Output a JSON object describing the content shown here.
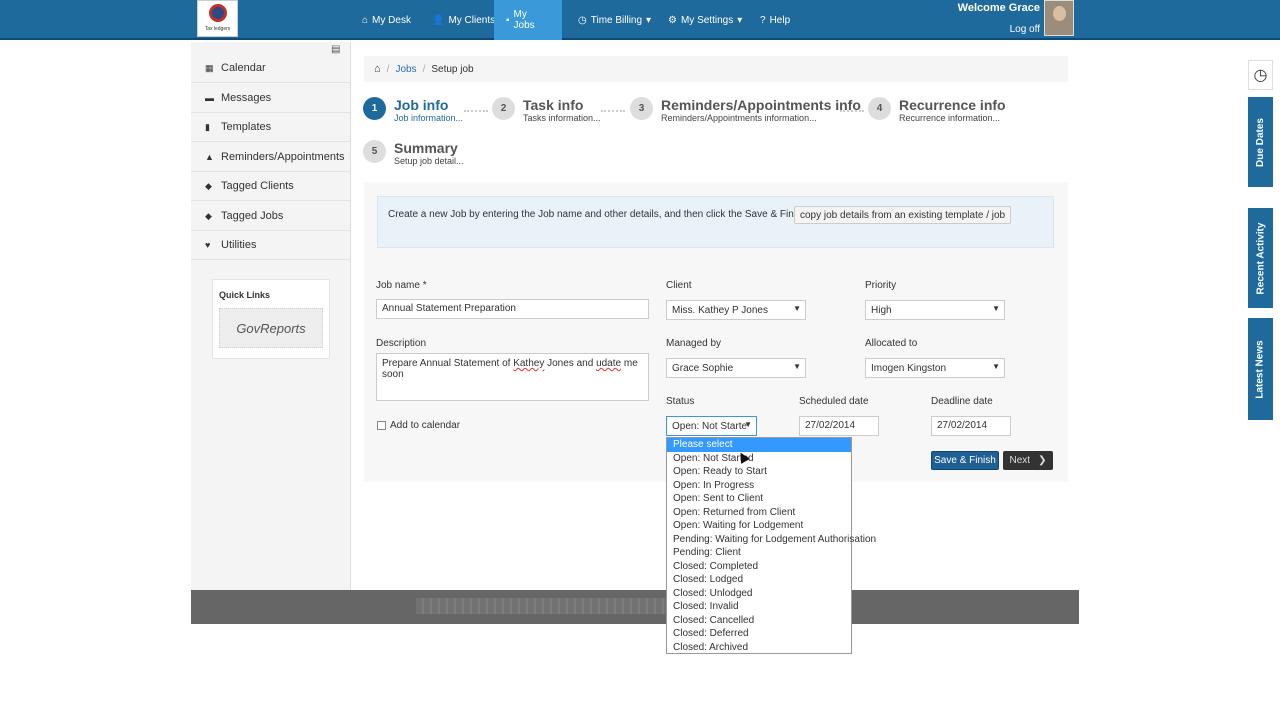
{
  "topbar": {
    "logo_caption": "Tax ledgers",
    "nav": [
      {
        "label": "My Desk",
        "icon": "home-icon",
        "glyph": "⌂"
      },
      {
        "label": "My Clients",
        "icon": "users-icon",
        "glyph": "👤"
      },
      {
        "label": "My Jobs",
        "icon": "briefcase-icon",
        "glyph": "▪"
      },
      {
        "label": "Time Billing",
        "icon": "clock-icon",
        "glyph": "◷"
      },
      {
        "label": "My Settings",
        "icon": "gear-icon",
        "glyph": "⚙"
      },
      {
        "label": "Help",
        "icon": "help-icon",
        "glyph": "?"
      }
    ],
    "welcome": "Welcome Grace",
    "logoff": "Log off"
  },
  "sidebar": {
    "items": [
      {
        "label": "Calendar",
        "icon": "calendar-icon",
        "glyph": "▦"
      },
      {
        "label": "Messages",
        "icon": "messages-icon",
        "glyph": "▬"
      },
      {
        "label": "Templates",
        "icon": "document-icon",
        "glyph": "▮"
      },
      {
        "label": "Reminders/Appointments",
        "icon": "bell-icon",
        "glyph": "▲"
      },
      {
        "label": "Tagged Clients",
        "icon": "tag-icon",
        "glyph": "◆"
      },
      {
        "label": "Tagged Jobs",
        "icon": "tag-icon",
        "glyph": "◆"
      },
      {
        "label": "Utilities",
        "icon": "heart-icon",
        "glyph": "♥"
      }
    ],
    "quick_links_title": "Quick Links",
    "govreports_label": "GovReports"
  },
  "breadcrumb": {
    "jobs": "Jobs",
    "current": "Setup job"
  },
  "steps": [
    {
      "num": "1",
      "title": "Job info",
      "sub": "Job information..."
    },
    {
      "num": "2",
      "title": "Task info",
      "sub": "Tasks information..."
    },
    {
      "num": "3",
      "title": "Reminders/Appointments info",
      "sub": "Reminders/Appointments information..."
    },
    {
      "num": "4",
      "title": "Recurrence info",
      "sub": "Recurrence information..."
    },
    {
      "num": "5",
      "title": "Summary",
      "sub": "Setup job detail..."
    }
  ],
  "info": {
    "text": "Create a new Job by entering the Job name and other details, and then click the Save & Finish button.  or",
    "copy_button": "copy job details from an existing template / job"
  },
  "form": {
    "job_name_label": "Job name *",
    "job_name_value": "Annual Statement Preparation",
    "client_label": "Client",
    "client_value": "Miss. Kathey P Jones",
    "priority_label": "Priority",
    "priority_value": "High",
    "description_label": "Description",
    "description_pre": "Prepare Annual Statement of ",
    "description_w1": "Kathey",
    "description_mid": " Jones and ",
    "description_w2": "udate",
    "description_post": " me soon",
    "managed_label": "Managed by",
    "managed_value": "Grace Sophie",
    "allocated_label": "Allocated to",
    "allocated_value": "Imogen Kingston",
    "status_label": "Status",
    "status_value": "Open: Not Starte",
    "scheduled_label": "Scheduled date",
    "scheduled_value": "27/02/2014",
    "deadline_label": "Deadline date",
    "deadline_value": "27/02/2014",
    "calendar_label": "Add to calendar",
    "save_label": "Save & Finish",
    "next_label": "Next"
  },
  "status_options": [
    "Please select",
    "Open: Not Started",
    "Open: Ready to Start",
    "Open: In Progress",
    "Open: Sent to Client",
    "Open: Returned from Client",
    "Open: Waiting for Lodgement",
    "Pending: Waiting for Lodgement Authorisation",
    "Pending: Client",
    "Closed: Completed",
    "Closed: Lodged",
    "Closed: Unlodged",
    "Closed: Invalid",
    "Closed: Cancelled",
    "Closed: Deferred",
    "Closed: Archived"
  ],
  "right_tabs": {
    "due": "Due Dates",
    "activity": "Recent Activity",
    "news": "Latest News"
  },
  "colors": {
    "brand": "#1f6a9c",
    "active_nav": "#3a99d8",
    "selected_option": "#3399ff"
  }
}
